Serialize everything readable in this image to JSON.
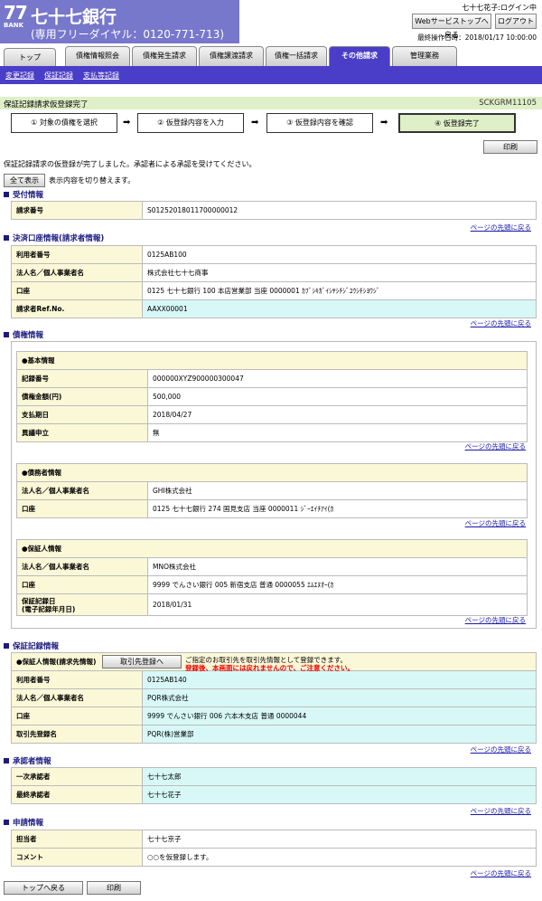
{
  "header": {
    "logo_num": "77",
    "logo_bank": "BANK",
    "bank_name": "七十七銀行",
    "tel": "(専用フリーダイヤル：0120-771-713)",
    "user": "七十七花子:ログイン中",
    "ws_top_button": "Webサービストップへ戻る",
    "logout_button": "ログアウト",
    "last_op": "最終操作日時：2018/01/17 10:00:00"
  },
  "tabs": [
    "トップ",
    "債権情報照会",
    "債権発生請求",
    "債権譲渡請求",
    "債権一括請求",
    "その他請求",
    "管理業務"
  ],
  "subnav": [
    "変更記録",
    "保証記録",
    "支払等記録"
  ],
  "title": {
    "text": "保証記録請求仮登録完了",
    "code": "SCKGRM11105"
  },
  "steps": [
    "① 対象の債権を選択",
    "② 仮登録内容を入力",
    "③ 仮登録内容を確認",
    "④ 仮登録完了"
  ],
  "print_label": "印刷",
  "message": "保証記録請求の仮登録が完了しました。承認者による承認を受けてください。",
  "show_all_button": "全て表示",
  "show_all_text": "表示内容を切り替えます。",
  "page_top": "ページの先頭に戻る",
  "sections": {
    "uketsuke": {
      "title": "受付情報",
      "rows": [
        {
          "k": "請求番号",
          "v": "S01252018011700000012"
        }
      ]
    },
    "kessai": {
      "title": "決済口座情報(請求者情報)",
      "rows": [
        {
          "k": "利用者番号",
          "v": "0125AB100"
        },
        {
          "k": "法人名／個人事業者名",
          "v": "株式会社七十七商事"
        },
        {
          "k": "口座",
          "v": "0125 七十七銀行 100 本店営業部 当座 0000001 ｶﾌﾞｼｷｶﾞｲｼﾔｼﾁｼﾞﾕｳｼﾁｼﾖｳｼﾞ"
        },
        {
          "k": "請求者Ref.No.",
          "v": "AAXX00001"
        }
      ]
    },
    "saiken": {
      "title": "債権情報",
      "kihon": {
        "title": "●基本情報",
        "rows": [
          {
            "k": "記録番号",
            "v": "000000XYZ900000300047"
          },
          {
            "k": "債権金額(円)",
            "v": "500,000"
          },
          {
            "k": "支払期日",
            "v": "2018/04/27"
          },
          {
            "k": "異議申立",
            "v": "無"
          }
        ]
      },
      "saimusha": {
        "title": "●債務者情報",
        "rows": [
          {
            "k": "法人名／個人事業者名",
            "v": "GHI株式会社"
          },
          {
            "k": "口座",
            "v": "0125 七十七銀行 274 国見支店 当座 0000011 ｼﾞｰｴｲﾁｱｲ(ｶ"
          }
        ]
      },
      "hoshonin": {
        "title": "●保証人情報",
        "rows": [
          {
            "k": "法人名／個人事業者名",
            "v": "MNO株式会社"
          },
          {
            "k": "口座",
            "v": "9999 でんさい銀行 005 新宿支店 普通 0000055 ｴﾑｴﾇｵｰ(ｶ"
          },
          {
            "k": "保証記録日\n(電子記録年月日)",
            "v": "2018/01/31"
          }
        ]
      }
    },
    "hosho": {
      "title": "保証記録情報",
      "sub_title": "●保証人情報(請求先情報)",
      "register_button": "取引先登録へ",
      "warn1": "ご指定のお取引先を取引先情報として登録できます。",
      "warn2": "登録後、本画面には戻れませんので、ご注意ください。",
      "rows": [
        {
          "k": "利用者番号",
          "v": "0125AB140"
        },
        {
          "k": "法人名／個人事業者名",
          "v": "PQR株式会社"
        },
        {
          "k": "口座",
          "v": "9999 でんさい銀行 006 六本木支店 普通 0000044"
        },
        {
          "k": "取引先登録名",
          "v": "PQR(株)営業部"
        }
      ]
    },
    "shonin": {
      "title": "承認者情報",
      "rows": [
        {
          "k": "一次承認者",
          "v": "七十七太郎"
        },
        {
          "k": "最終承認者",
          "v": "七十七花子"
        }
      ]
    },
    "shinsei": {
      "title": "申請情報",
      "rows": [
        {
          "k": "担当者",
          "v": "七十七京子"
        },
        {
          "k": "コメント",
          "v": "○○を仮登録します。"
        }
      ]
    }
  },
  "bottom": {
    "top_button": "トップへ戻る",
    "print_button": "印刷"
  }
}
